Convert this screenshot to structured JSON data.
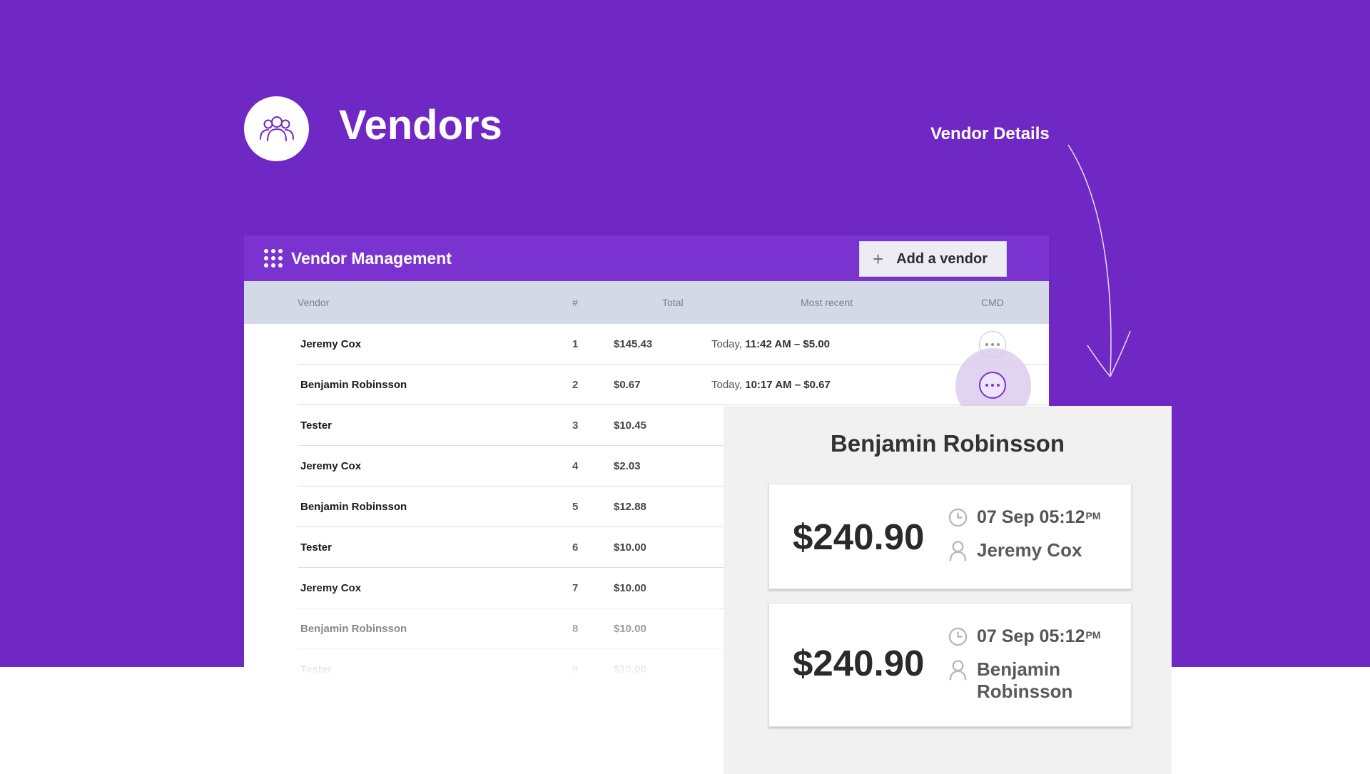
{
  "hero": {
    "title": "Vendors"
  },
  "annotation": {
    "label": "Vendor Details"
  },
  "panel": {
    "title": "Vendor Management",
    "add_button_label": "Add a vendor",
    "columns": [
      "Vendor",
      "#",
      "Total",
      "Most recent",
      "CMD"
    ],
    "rows": [
      {
        "vendor": "Jeremy Cox",
        "num": "1",
        "total": "$145.43",
        "recent_prefix": "Today, ",
        "recent_detail": "11:42 AM – $5.00"
      },
      {
        "vendor": "Benjamin Robinsson",
        "num": "2",
        "total": "$0.67",
        "recent_prefix": "Today, ",
        "recent_detail": "10:17 AM – $0.67"
      },
      {
        "vendor": "Tester",
        "num": "3",
        "total": "$10.45"
      },
      {
        "vendor": "Jeremy Cox",
        "num": "4",
        "total": "$2.03"
      },
      {
        "vendor": "Benjamin Robinsson",
        "num": "5",
        "total": "$12.88"
      },
      {
        "vendor": "Tester",
        "num": "6",
        "total": "$10.00"
      },
      {
        "vendor": "Jeremy Cox",
        "num": "7",
        "total": "$10.00"
      },
      {
        "vendor": "Benjamin Robinsson",
        "num": "8",
        "total": "$10.00"
      },
      {
        "vendor": "Tester",
        "num": "9",
        "total": "$10.00"
      }
    ]
  },
  "details": {
    "name": "Benjamin Robinsson",
    "transactions": [
      {
        "amount": "$240.90",
        "date": "07 Sep 05:12",
        "period": "PM",
        "person": "Jeremy Cox"
      },
      {
        "amount": "$240.90",
        "date": "07 Sep 05:12",
        "period": "PM",
        "person_line1": "Benjamin",
        "person_line2": "Robinsson"
      }
    ]
  },
  "colors": {
    "background_purple": "#7028c4",
    "header_purple": "#7a33d0",
    "table_header": "#d4d9e7",
    "details_bg": "#f1f1f1"
  },
  "icons": [
    "users-icon",
    "grid-dots-icon",
    "plus-icon",
    "more-dots-icon",
    "clock-icon",
    "person-icon",
    "curved-arrow-icon"
  ]
}
